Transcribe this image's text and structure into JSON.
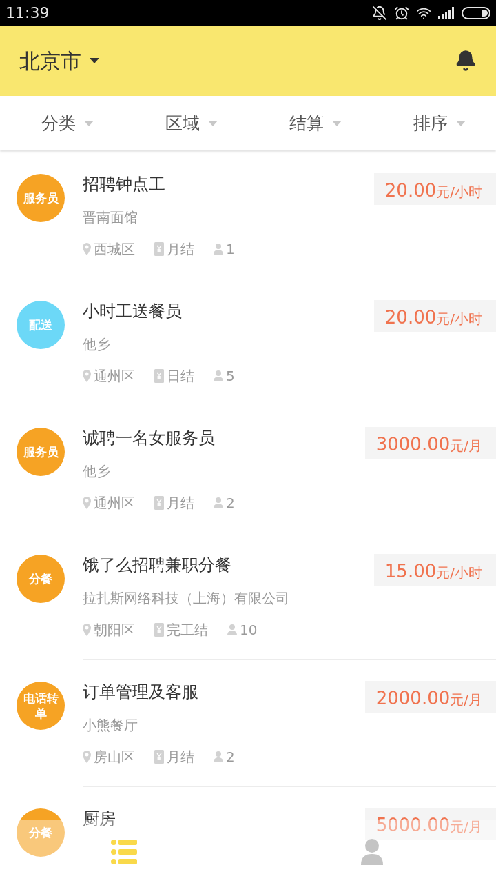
{
  "status_bar": {
    "time": "11:39"
  },
  "header": {
    "city": "北京市"
  },
  "filters": [
    {
      "label": "分类"
    },
    {
      "label": "区域"
    },
    {
      "label": "结算"
    },
    {
      "label": "排序"
    }
  ],
  "jobs": [
    {
      "badge": "服务员",
      "color": "#f6a324",
      "title": "招聘钟点工",
      "price": "20.00",
      "unit": "元/小时",
      "company": "晋南面馆",
      "district": "西城区",
      "settlement": "月结",
      "headcount": "1"
    },
    {
      "badge": "配送",
      "color": "#6cd8f7",
      "title": "小时工送餐员",
      "price": "20.00",
      "unit": "元/小时",
      "company": "他乡",
      "district": "通州区",
      "settlement": "日结",
      "headcount": "5"
    },
    {
      "badge": "服务员",
      "color": "#f6a324",
      "title": "诚聘一名女服务员",
      "price": "3000.00",
      "unit": "元/月",
      "company": "他乡",
      "district": "通州区",
      "settlement": "月结",
      "headcount": "2"
    },
    {
      "badge": "分餐",
      "color": "#f6a324",
      "title": "饿了么招聘兼职分餐",
      "price": "15.00",
      "unit": "元/小时",
      "company": "拉扎斯网络科技（上海）有限公司",
      "district": "朝阳区",
      "settlement": "完工结",
      "headcount": "10"
    },
    {
      "badge": "电话转单",
      "color": "#f6a324",
      "title": "订单管理及客服",
      "price": "2000.00",
      "unit": "元/月",
      "company": "小熊餐厅",
      "district": "房山区",
      "settlement": "月结",
      "headcount": "2"
    },
    {
      "badge": "分餐",
      "color": "#f6a324",
      "title": "厨房",
      "price": "5000.00",
      "unit": "元/月"
    }
  ],
  "tab_bar": [
    {
      "kind": "list",
      "selected": true
    },
    {
      "kind": "profile",
      "selected": false
    }
  ]
}
